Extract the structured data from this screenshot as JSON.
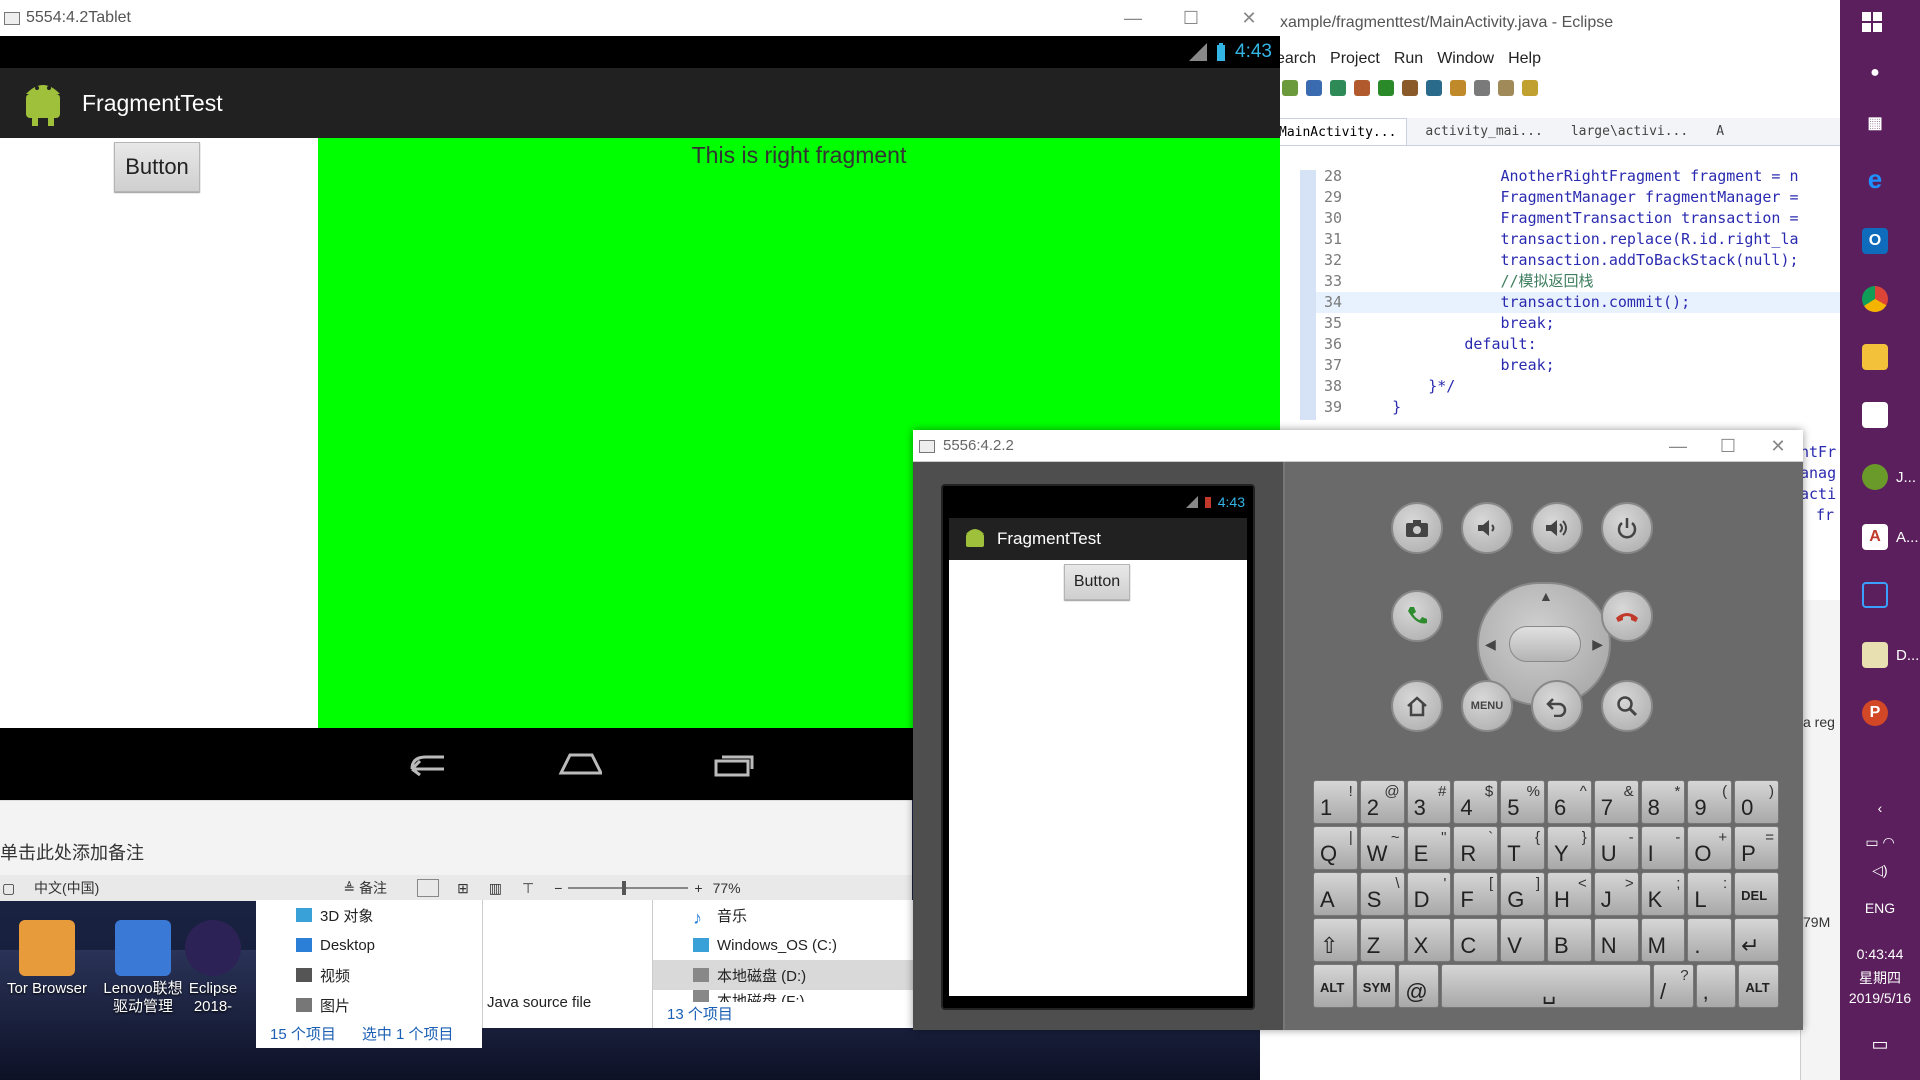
{
  "desktop": {
    "icons": [
      {
        "label": "Tor Browser",
        "color": "#e89b3a"
      },
      {
        "label": "Lenovo联想驱动管理",
        "color": "#3b79d6"
      },
      {
        "label": "Eclipse 2018-",
        "color": "#2c2255"
      }
    ]
  },
  "eclipse": {
    "title": "xample/fragmenttest/MainActivity.java - Eclipse",
    "menu": [
      "earch",
      "Project",
      "Run",
      "Window",
      "Help"
    ],
    "tabs": [
      "MainActivity...",
      "activity_mai...",
      "large\\activi...",
      "A"
    ],
    "code_lines": [
      {
        "n": "28",
        "text": "AnotherRightFragment fragment = n",
        "indent": 16
      },
      {
        "n": "29",
        "text": "FragmentManager fragmentManager =",
        "indent": 16
      },
      {
        "n": "30",
        "text": "FragmentTransaction transaction =",
        "indent": 16
      },
      {
        "n": "31",
        "text": "transaction.replace(R.id.right_la",
        "indent": 16
      },
      {
        "n": "32",
        "text": "transaction.addToBackStack(null);",
        "indent": 16
      },
      {
        "n": "33",
        "text": "//模拟返回栈",
        "indent": 16,
        "comment": true
      },
      {
        "n": "34",
        "text": "transaction.commit();",
        "indent": 16,
        "highlight": true
      },
      {
        "n": "35",
        "text": "break;",
        "indent": 16
      },
      {
        "n": "36",
        "text": "default:",
        "indent": 12
      },
      {
        "n": "37",
        "text": "break;",
        "indent": 16
      },
      {
        "n": "38",
        "text": "}*/",
        "indent": 8
      },
      {
        "n": "39",
        "text": "}",
        "indent": 4
      }
    ],
    "side_fragments": [
      "ntFr",
      "anag",
      "acti",
      "fr"
    ],
    "side_text_1": "a reg",
    "side_text_2": "79M"
  },
  "tablet": {
    "window_title": "5554:4.2Tablet",
    "clock": "4:43",
    "app_title": "FragmentTest",
    "button_label": "Button",
    "right_fragment_text": "This is right fragment"
  },
  "ppt": {
    "notes_placeholder": "单击此处添加备注",
    "language": "中文(中国)",
    "notes_label": "备注",
    "zoom": "77%"
  },
  "explorer_left": {
    "items": [
      "3D 对象",
      "Desktop",
      "视频",
      "图片"
    ],
    "count": "15 个项目",
    "selected": "选中 1 个项目"
  },
  "explorer_mid": {
    "type": "Java source file"
  },
  "explorer_right": {
    "items": [
      "音乐",
      "Windows_OS (C:)",
      "本地磁盘 (D:)",
      "本地磁盘 (F:)"
    ],
    "count": "13 个项目"
  },
  "phone": {
    "window_title": "5556:4.2.2",
    "clock": "4:43",
    "app_title": "FragmentTest",
    "button_label": "Button",
    "keyboard": [
      [
        {
          "m": "1",
          "a": "!"
        },
        {
          "m": "2",
          "a": "@"
        },
        {
          "m": "3",
          "a": "#"
        },
        {
          "m": "4",
          "a": "$"
        },
        {
          "m": "5",
          "a": "%"
        },
        {
          "m": "6",
          "a": "^"
        },
        {
          "m": "7",
          "a": "&"
        },
        {
          "m": "8",
          "a": "*"
        },
        {
          "m": "9",
          "a": "("
        },
        {
          "m": "0",
          "a": ")"
        }
      ],
      [
        {
          "m": "Q",
          "a": "|"
        },
        {
          "m": "W",
          "a": "~"
        },
        {
          "m": "E",
          "a": "\""
        },
        {
          "m": "R",
          "a": "`"
        },
        {
          "m": "T",
          "a": "{"
        },
        {
          "m": "Y",
          "a": "}"
        },
        {
          "m": "U",
          "a": "-"
        },
        {
          "m": "I",
          "a": "-"
        },
        {
          "m": "O",
          "a": "+"
        },
        {
          "m": "P",
          "a": "="
        }
      ],
      [
        {
          "m": "A",
          "a": ""
        },
        {
          "m": "S",
          "a": "\\"
        },
        {
          "m": "D",
          "a": "'"
        },
        {
          "m": "F",
          "a": "["
        },
        {
          "m": "G",
          "a": "]"
        },
        {
          "m": "H",
          "a": "<"
        },
        {
          "m": "J",
          "a": ">"
        },
        {
          "m": "K",
          "a": ";"
        },
        {
          "m": "L",
          "a": ":"
        },
        {
          "m": "DEL",
          "a": ""
        }
      ],
      [
        {
          "m": "⇧",
          "a": ""
        },
        {
          "m": "Z",
          "a": ""
        },
        {
          "m": "X",
          "a": ""
        },
        {
          "m": "C",
          "a": ""
        },
        {
          "m": "V",
          "a": ""
        },
        {
          "m": "B",
          "a": ""
        },
        {
          "m": "N",
          "a": ""
        },
        {
          "m": "M",
          "a": ""
        },
        {
          "m": ".",
          "a": ""
        },
        {
          "m": "↵",
          "a": ""
        }
      ]
    ],
    "bottom_keys": {
      "alt_left": "ALT",
      "sym": "SYM",
      "at": "@",
      "space": "␣",
      "slash": "/",
      "slash_alt": "?",
      "comma": ",",
      "alt_right": "ALT"
    },
    "menu_label": "MENU"
  },
  "taskbar": {
    "items": [
      "J...",
      "A...",
      "D..."
    ],
    "lang": "ENG",
    "time": "0:43:44",
    "weekday": "星期四",
    "date": "2019/5/16"
  },
  "colors": {
    "fragment_green": "#00ff00",
    "android_clock": "#33b5e5",
    "taskbar": "#5a1f5c"
  }
}
